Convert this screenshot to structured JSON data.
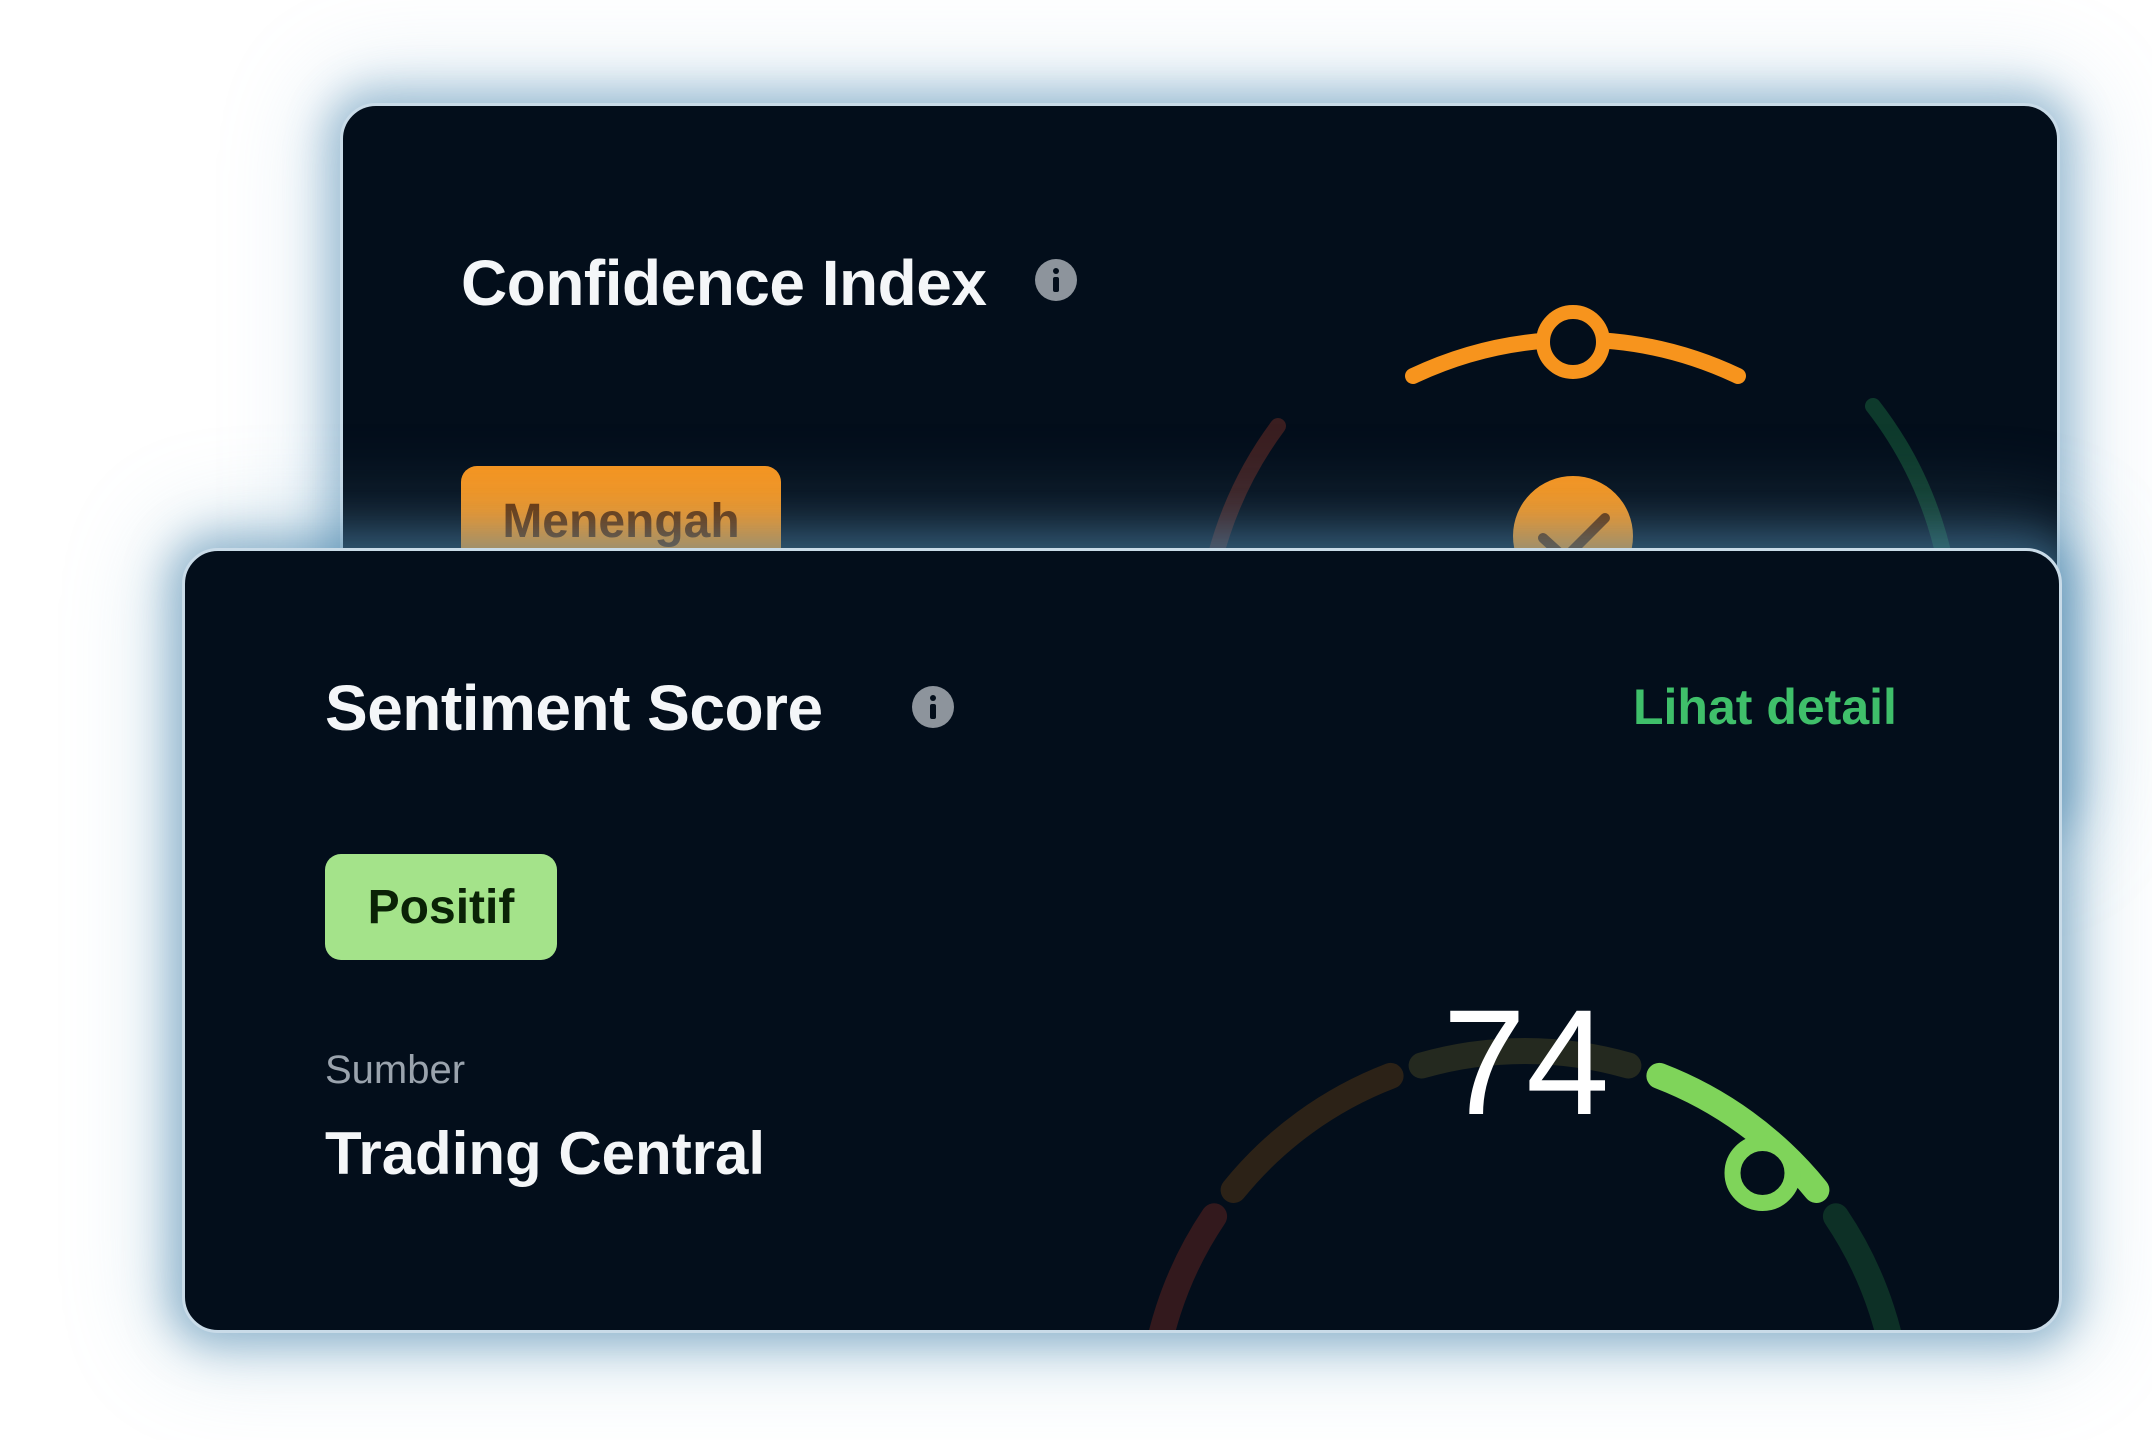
{
  "confidence_card": {
    "title": "Confidence Index",
    "level_badge": "Menengah",
    "accent_color": "#f7941d"
  },
  "sentiment_card": {
    "title": "Sentiment Score",
    "detail_link": "Lihat detail",
    "sentiment_badge": "Positif",
    "source_label": "Sumber",
    "source_value": "Trading Central",
    "score": "74",
    "score_value": 74,
    "score_max": 100,
    "accent_color": "#7fd45a"
  },
  "icons": [
    "info-icon",
    "checkmark-icon",
    "gauge-indicator-icon"
  ]
}
